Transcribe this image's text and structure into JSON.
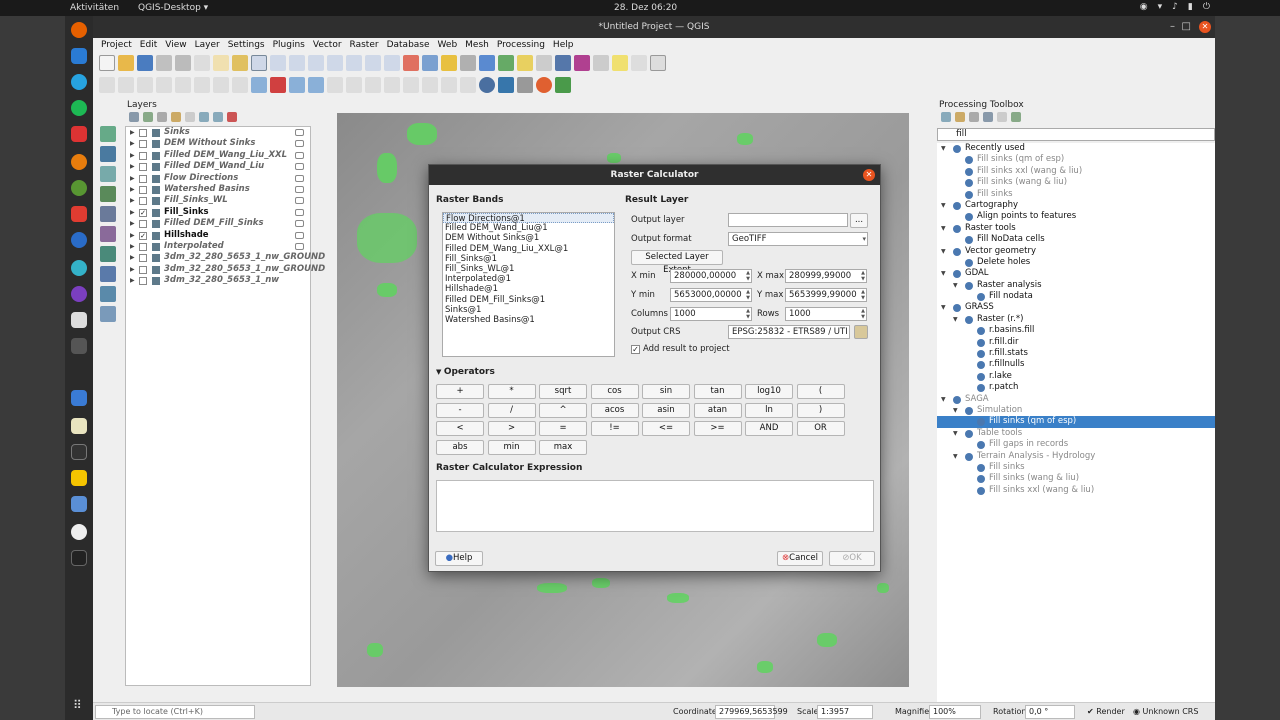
{
  "topbar": {
    "activities": "Aktivitäten",
    "app_name": "QGIS-Desktop ▾",
    "clock": "28. Dez  06:20"
  },
  "window": {
    "title": "*Untitled Project — QGIS"
  },
  "menu": [
    "Project",
    "Edit",
    "View",
    "Layer",
    "Settings",
    "Plugins",
    "Vector",
    "Raster",
    "Database",
    "Web",
    "Mesh",
    "Processing",
    "Help"
  ],
  "layers_panel": {
    "title": "Layers",
    "items": [
      {
        "name": "Sinks",
        "checked": false,
        "visible": false
      },
      {
        "name": "DEM Without Sinks",
        "checked": false,
        "visible": false
      },
      {
        "name": "Filled DEM_Wang_Liu_XXL",
        "checked": false,
        "visible": false
      },
      {
        "name": "Filled DEM_Wand_Liu",
        "checked": false,
        "visible": false
      },
      {
        "name": "Flow Directions",
        "checked": false,
        "visible": false
      },
      {
        "name": "Watershed Basins",
        "checked": false,
        "visible": false
      },
      {
        "name": "Fill_Sinks_WL",
        "checked": false,
        "visible": false
      },
      {
        "name": "Fill_Sinks",
        "checked": true,
        "visible": true
      },
      {
        "name": "Filled DEM_Fill_Sinks",
        "checked": false,
        "visible": false
      },
      {
        "name": "Hillshade",
        "checked": true,
        "visible": true
      },
      {
        "name": "Interpolated",
        "checked": false,
        "visible": false
      },
      {
        "name": "3dm_32_280_5653_1_nw_GROUND",
        "checked": false,
        "visible": false
      },
      {
        "name": "3dm_32_280_5653_1_nw_GROUND",
        "checked": false,
        "visible": false
      },
      {
        "name": "3dm_32_280_5653_1_nw",
        "checked": false,
        "visible": false
      }
    ]
  },
  "toolbox": {
    "title": "Processing Toolbox",
    "search": "fill",
    "tree": [
      {
        "label": "Recently used",
        "level": 0,
        "grey": false,
        "selected": false
      },
      {
        "label": "Fill sinks (qm of esp)",
        "level": 1,
        "grey": true,
        "selected": false
      },
      {
        "label": "Fill sinks xxl (wang & liu)",
        "level": 1,
        "grey": true,
        "selected": false
      },
      {
        "label": "Fill sinks (wang & liu)",
        "level": 1,
        "grey": true,
        "selected": false
      },
      {
        "label": "Fill sinks",
        "level": 1,
        "grey": true,
        "selected": false
      },
      {
        "label": "Cartography",
        "level": 0,
        "grey": false,
        "selected": false
      },
      {
        "label": "Align points to features",
        "level": 1,
        "grey": false,
        "selected": false
      },
      {
        "label": "Raster tools",
        "level": 0,
        "grey": false,
        "selected": false
      },
      {
        "label": "Fill NoData cells",
        "level": 1,
        "grey": false,
        "selected": false
      },
      {
        "label": "Vector geometry",
        "level": 0,
        "grey": false,
        "selected": false
      },
      {
        "label": "Delete holes",
        "level": 1,
        "grey": false,
        "selected": false
      },
      {
        "label": "GDAL",
        "level": 0,
        "grey": false,
        "selected": false
      },
      {
        "label": "Raster analysis",
        "level": 1,
        "grey": false,
        "selected": false
      },
      {
        "label": "Fill nodata",
        "level": 2,
        "grey": false,
        "selected": false
      },
      {
        "label": "GRASS",
        "level": 0,
        "grey": false,
        "selected": false
      },
      {
        "label": "Raster (r.*)",
        "level": 1,
        "grey": false,
        "selected": false
      },
      {
        "label": "r.basins.fill",
        "level": 2,
        "grey": false,
        "selected": false
      },
      {
        "label": "r.fill.dir",
        "level": 2,
        "grey": false,
        "selected": false
      },
      {
        "label": "r.fill.stats",
        "level": 2,
        "grey": false,
        "selected": false
      },
      {
        "label": "r.fillnulls",
        "level": 2,
        "grey": false,
        "selected": false
      },
      {
        "label": "r.lake",
        "level": 2,
        "grey": false,
        "selected": false
      },
      {
        "label": "r.patch",
        "level": 2,
        "grey": false,
        "selected": false
      },
      {
        "label": "SAGA",
        "level": 0,
        "grey": true,
        "selected": false
      },
      {
        "label": "Simulation",
        "level": 1,
        "grey": true,
        "selected": false
      },
      {
        "label": "Fill sinks (qm of esp)",
        "level": 2,
        "grey": false,
        "selected": true
      },
      {
        "label": "Table tools",
        "level": 1,
        "grey": true,
        "selected": false
      },
      {
        "label": "Fill gaps in records",
        "level": 2,
        "grey": true,
        "selected": false
      },
      {
        "label": "Terrain Analysis - Hydrology",
        "level": 1,
        "grey": true,
        "selected": false
      },
      {
        "label": "Fill sinks",
        "level": 2,
        "grey": true,
        "selected": false
      },
      {
        "label": "Fill sinks (wang & liu)",
        "level": 2,
        "grey": true,
        "selected": false
      },
      {
        "label": "Fill sinks xxl (wang & liu)",
        "level": 2,
        "grey": true,
        "selected": false
      }
    ]
  },
  "dialog": {
    "title": "Raster Calculator",
    "raster_bands_title": "Raster Bands",
    "bands": [
      "Flow Directions@1",
      "Filled DEM_Wand_Liu@1",
      "DEM Without Sinks@1",
      "Filled DEM_Wang_Liu_XXL@1",
      "Fill_Sinks@1",
      "Fill_Sinks_WL@1",
      "Interpolated@1",
      "Hillshade@1",
      "Filled DEM_Fill_Sinks@1",
      "Sinks@1",
      "Watershed Basins@1"
    ],
    "result_title": "Result Layer",
    "output_layer_label": "Output layer",
    "output_layer_value": "",
    "browse_label": "...",
    "output_format_label": "Output format",
    "output_format_value": "GeoTIFF",
    "extent_button": "Selected Layer Extent",
    "xmin_label": "X min",
    "xmin_value": "280000,00000",
    "xmax_label": "X max",
    "xmax_value": "280999,99000",
    "ymin_label": "Y min",
    "ymin_value": "5653000,00000",
    "ymax_label": "Y max",
    "ymax_value": "5653999,99000",
    "columns_label": "Columns",
    "columns_value": "1000",
    "rows_label": "Rows",
    "rows_value": "1000",
    "crs_label": "Output CRS",
    "crs_value": "EPSG:25832 - ETRS89 / UTI ▾",
    "add_result_label": "Add result to project",
    "add_result_checked": true,
    "operators_title": "Operators",
    "operators": [
      [
        "+",
        "*",
        "sqrt",
        "cos",
        "sin",
        "tan",
        "log10",
        "("
      ],
      [
        "-",
        "/",
        "^",
        "acos",
        "asin",
        "atan",
        "ln",
        ")"
      ],
      [
        "<",
        ">",
        "=",
        "!=",
        "<=",
        ">=",
        "AND",
        "OR"
      ],
      [
        "abs",
        "min",
        "max"
      ]
    ],
    "expression_title": "Raster Calculator Expression",
    "expression_value": "",
    "help_label": "Help",
    "cancel_label": "Cancel",
    "ok_label": "OK"
  },
  "status": {
    "locate_placeholder": "Type to locate (Ctrl+K)",
    "coordinate_label": "Coordinate",
    "coordinate_value": "279969,5653599",
    "scale_label": "Scale",
    "scale_value": "1:3957",
    "magnifier_label": "Magnifier",
    "magnifier_value": "100%",
    "rotation_label": "Rotation",
    "rotation_value": "0,0 °",
    "render_label": "Render",
    "crs_label": "Unknown CRS"
  },
  "colors": {
    "accent": "#e95420",
    "selection": "#3a80c8",
    "raster_green": "#5fd45f"
  }
}
